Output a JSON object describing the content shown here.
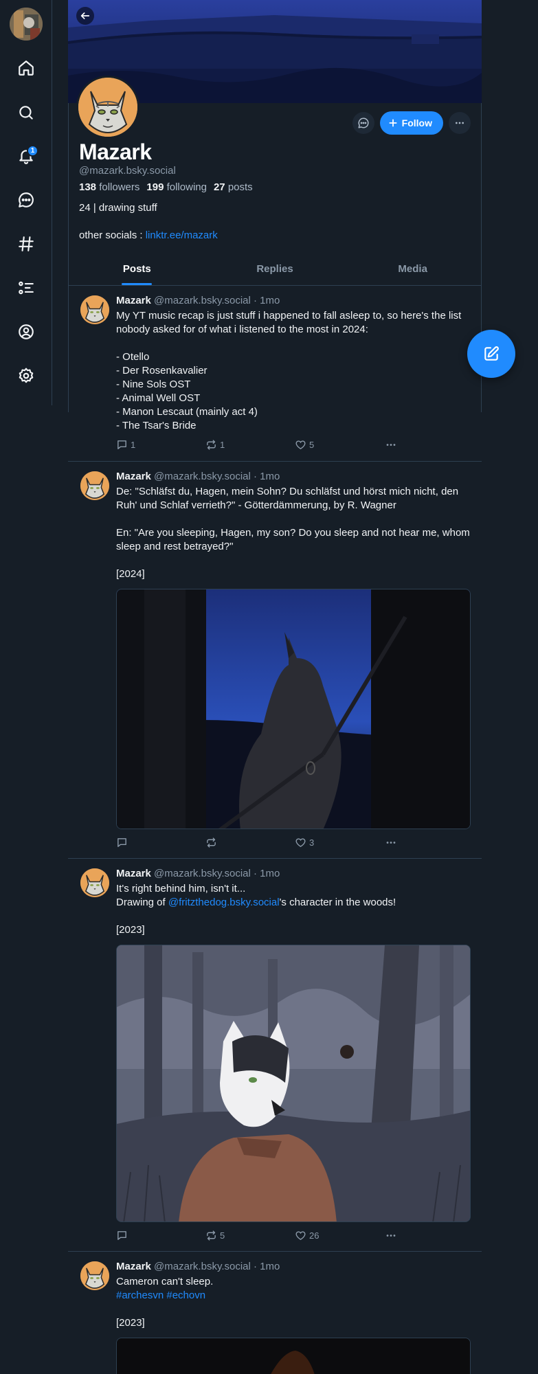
{
  "notifications_badge": "1",
  "profile": {
    "name": "Mazark",
    "handle": "@mazark.bsky.social",
    "followers_count": "138",
    "followers_label": "followers",
    "following_count": "199",
    "following_label": "following",
    "posts_count": "27",
    "posts_label": "posts",
    "bio_line1": "24 | drawing stuff",
    "bio_line2_prefix": "other socials : ",
    "bio_link": "linktr.ee/mazark",
    "follow_label": "Follow"
  },
  "tabs": [
    "Posts",
    "Replies",
    "Media"
  ],
  "posts": [
    {
      "author": "Mazark",
      "meta": "@mazark.bsky.social · 1mo",
      "lines": [
        "My YT music recap is just stuff i happened to fall asleep to, so here's the list nobody asked for of what i listened to the most in 2024:",
        "",
        "- Otello",
        "- Der Rosenkavalier",
        "- Nine Sols OST",
        "- Animal Well OST",
        "- Manon Lescaut (mainly act 4)",
        "- The Tsar's Bride"
      ],
      "replies": "1",
      "reposts": "1",
      "likes": "5"
    },
    {
      "author": "Mazark",
      "meta": "@mazark.bsky.social · 1mo",
      "lines": [
        "De: \"Schläfst du, Hagen, mein Sohn? Du schläfst und hörst mich nicht, den Ruh' und Schlaf verrieth?\" - Götterdämmerung, by R. Wagner",
        "",
        "En: \"Are you sleeping, Hagen, my son? Do you sleep and not hear me, whom sleep and rest betrayed?\"",
        "",
        "[2024]"
      ],
      "replies": "",
      "reposts": "",
      "likes": "3"
    },
    {
      "author": "Mazark",
      "meta": "@mazark.bsky.social · 1mo",
      "line1": "It's right behind him, isn't it...",
      "line2_prefix": "Drawing of ",
      "line2_mention": "@fritzthedog.bsky.social",
      "line2_suffix": "'s character in the woods!",
      "line3": "[2023]",
      "replies": "",
      "reposts": "5",
      "likes": "26"
    },
    {
      "author": "Mazark",
      "meta": "@mazark.bsky.social · 1mo",
      "line1": "Cameron can't sleep.",
      "tags": "#archesvn #echovn",
      "line3": "[2023]"
    }
  ],
  "colors": {
    "background": "#161e27",
    "accent": "#208bfe",
    "border": "#2e4052",
    "muted_text": "#8b99a8"
  },
  "icons": [
    "home-icon",
    "search-icon",
    "bell-icon",
    "chat-icon",
    "hashtag-icon",
    "list-icon",
    "profile-icon",
    "settings-icon",
    "compose-icon",
    "back-arrow-icon",
    "ellipsis-icon",
    "reply-icon",
    "repost-icon",
    "heart-icon"
  ]
}
